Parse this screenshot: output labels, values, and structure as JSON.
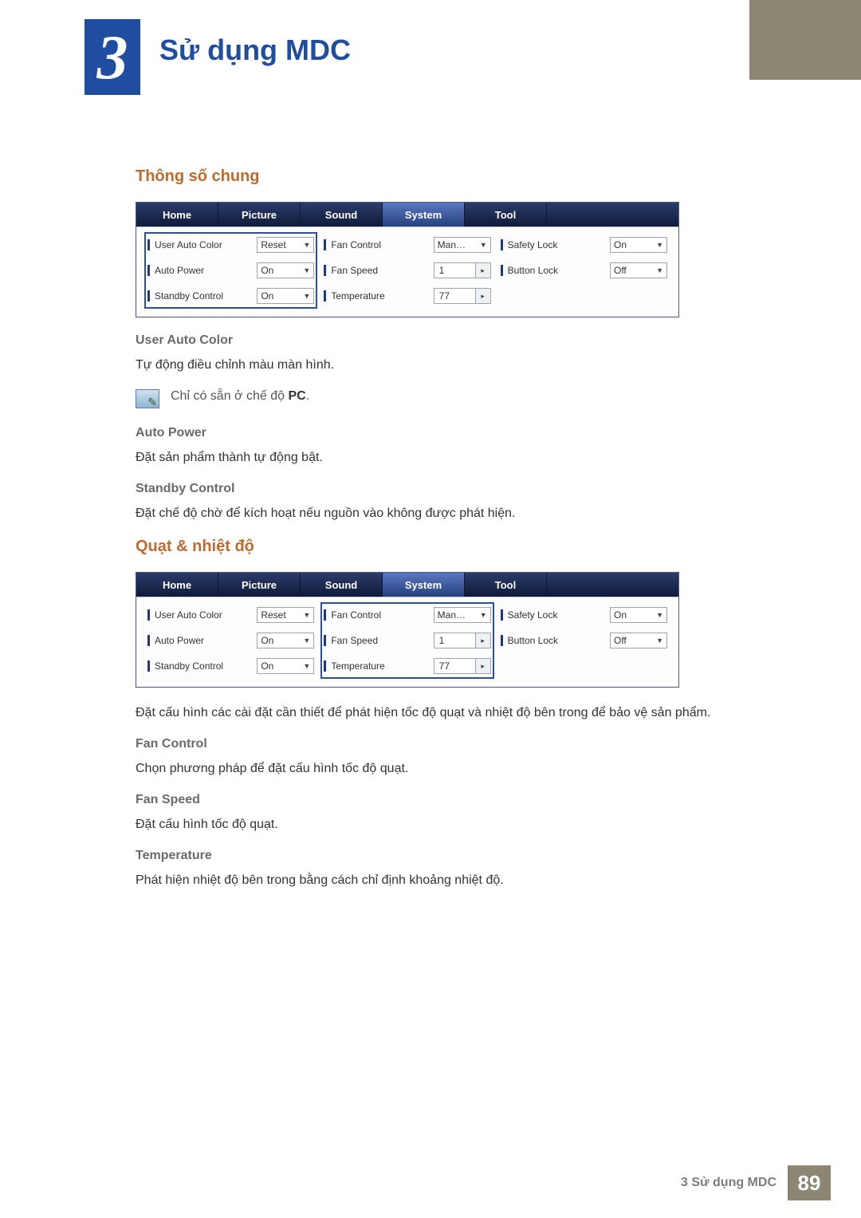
{
  "chapter": {
    "number": "3",
    "title": "Sử dụng MDC"
  },
  "footer": {
    "label": "3 Sử dụng MDC",
    "page": "89"
  },
  "section1": {
    "heading": "Thông số chung",
    "tabs": [
      "Home",
      "Picture",
      "Sound",
      "System",
      "Tool"
    ],
    "activeTab": 3,
    "highlightCol": 0,
    "col1": [
      {
        "label": "User Auto Color",
        "value": "Reset",
        "kind": "dd"
      },
      {
        "label": "Auto Power",
        "value": "On",
        "kind": "dd"
      },
      {
        "label": "Standby Control",
        "value": "On",
        "kind": "dd"
      }
    ],
    "col2": [
      {
        "label": "Fan Control",
        "value": "Man…",
        "kind": "dd"
      },
      {
        "label": "Fan Speed",
        "value": "1",
        "kind": "spin"
      },
      {
        "label": "Temperature",
        "value": "77",
        "kind": "spin"
      }
    ],
    "col3": [
      {
        "label": "Safety Lock",
        "value": "On",
        "kind": "dd"
      },
      {
        "label": "Button Lock",
        "value": "Off",
        "kind": "dd"
      }
    ],
    "items": [
      {
        "h": "User Auto Color",
        "p": "Tự động điều chỉnh màu màn hình.",
        "note_pre": "Chỉ có sẵn ở chế độ ",
        "note_b": "PC",
        "note_post": "."
      },
      {
        "h": "Auto Power",
        "p": "Đặt sản phẩm thành tự động bật."
      },
      {
        "h": "Standby Control",
        "p": "Đặt chế độ chờ để kích hoạt nếu nguồn vào không được phát hiện."
      }
    ]
  },
  "section2": {
    "heading": "Quạt & nhiệt độ",
    "tabs": [
      "Home",
      "Picture",
      "Sound",
      "System",
      "Tool"
    ],
    "activeTab": 3,
    "highlightCol": 1,
    "col1": [
      {
        "label": "User Auto Color",
        "value": "Reset",
        "kind": "dd"
      },
      {
        "label": "Auto Power",
        "value": "On",
        "kind": "dd"
      },
      {
        "label": "Standby Control",
        "value": "On",
        "kind": "dd"
      }
    ],
    "col2": [
      {
        "label": "Fan Control",
        "value": "Man…",
        "kind": "dd"
      },
      {
        "label": "Fan Speed",
        "value": "1",
        "kind": "spin"
      },
      {
        "label": "Temperature",
        "value": "77",
        "kind": "spin"
      }
    ],
    "col3": [
      {
        "label": "Safety Lock",
        "value": "On",
        "kind": "dd"
      },
      {
        "label": "Button Lock",
        "value": "Off",
        "kind": "dd"
      }
    ],
    "intro": "Đặt cấu hình các cài đặt cần thiết để phát hiện tốc độ quạt và nhiệt độ bên trong để bảo vệ sản phẩm.",
    "items": [
      {
        "h": "Fan Control",
        "p": "Chọn phương pháp để đặt cấu hình tốc độ quạt."
      },
      {
        "h": "Fan Speed",
        "p": "Đặt cấu hình tốc độ quạt."
      },
      {
        "h": "Temperature",
        "p": "Phát hiện nhiệt độ bên trong bằng cách chỉ định khoảng nhiệt độ."
      }
    ]
  }
}
